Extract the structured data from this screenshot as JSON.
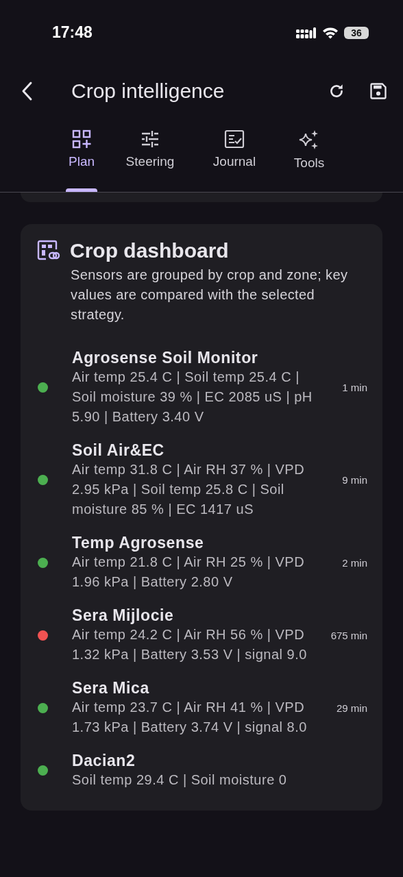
{
  "status_bar": {
    "time": "17:48",
    "battery": "36"
  },
  "header": {
    "title": "Crop intelligence"
  },
  "tabs": [
    {
      "label": "Plan",
      "selected": true
    },
    {
      "label": "Steering",
      "selected": false
    },
    {
      "label": "Journal",
      "selected": false
    },
    {
      "label": "Tools",
      "selected": false
    }
  ],
  "dashboard": {
    "title": "Crop dashboard",
    "description": "Sensors are grouped by crop and zone; key values are compared with the selected strategy.",
    "sensors": [
      {
        "name": "Agrosense Soil Monitor",
        "readings": "Air temp 25.4 C | Soil temp 25.4 C | Soil moisture 39 % | EC 2085 uS | pH 5.90 | Battery 3.40 V",
        "age": "1 min",
        "color": "#4caf50"
      },
      {
        "name": "Soil Air&EC",
        "readings": "Air temp 31.8 C | Air RH 37 % | VPD 2.95 kPa | Soil temp 25.8 C | Soil moisture 85 % | EC 1417 uS",
        "age": "9 min",
        "color": "#4caf50"
      },
      {
        "name": "Temp Agrosense",
        "readings": "Air temp 21.8 C | Air RH 25 % | VPD 1.96 kPa | Battery 2.80 V",
        "age": "2 min",
        "color": "#4caf50"
      },
      {
        "name": "Sera Mijlocie",
        "readings": "Air temp 24.2 C | Air RH 56 % | VPD 1.32 kPa | Battery 3.53 V | signal 9.0",
        "age": "675 min",
        "color": "#f05252"
      },
      {
        "name": "Sera Mica",
        "readings": "Air temp 23.7 C | Air RH 41 % | VPD 1.73 kPa | Battery 3.74 V | signal 8.0",
        "age": "29 min",
        "color": "#4caf50"
      },
      {
        "name": "Dacian2",
        "readings": "Soil temp 29.4 C | Soil moisture 0",
        "color": "#4caf50"
      }
    ]
  }
}
